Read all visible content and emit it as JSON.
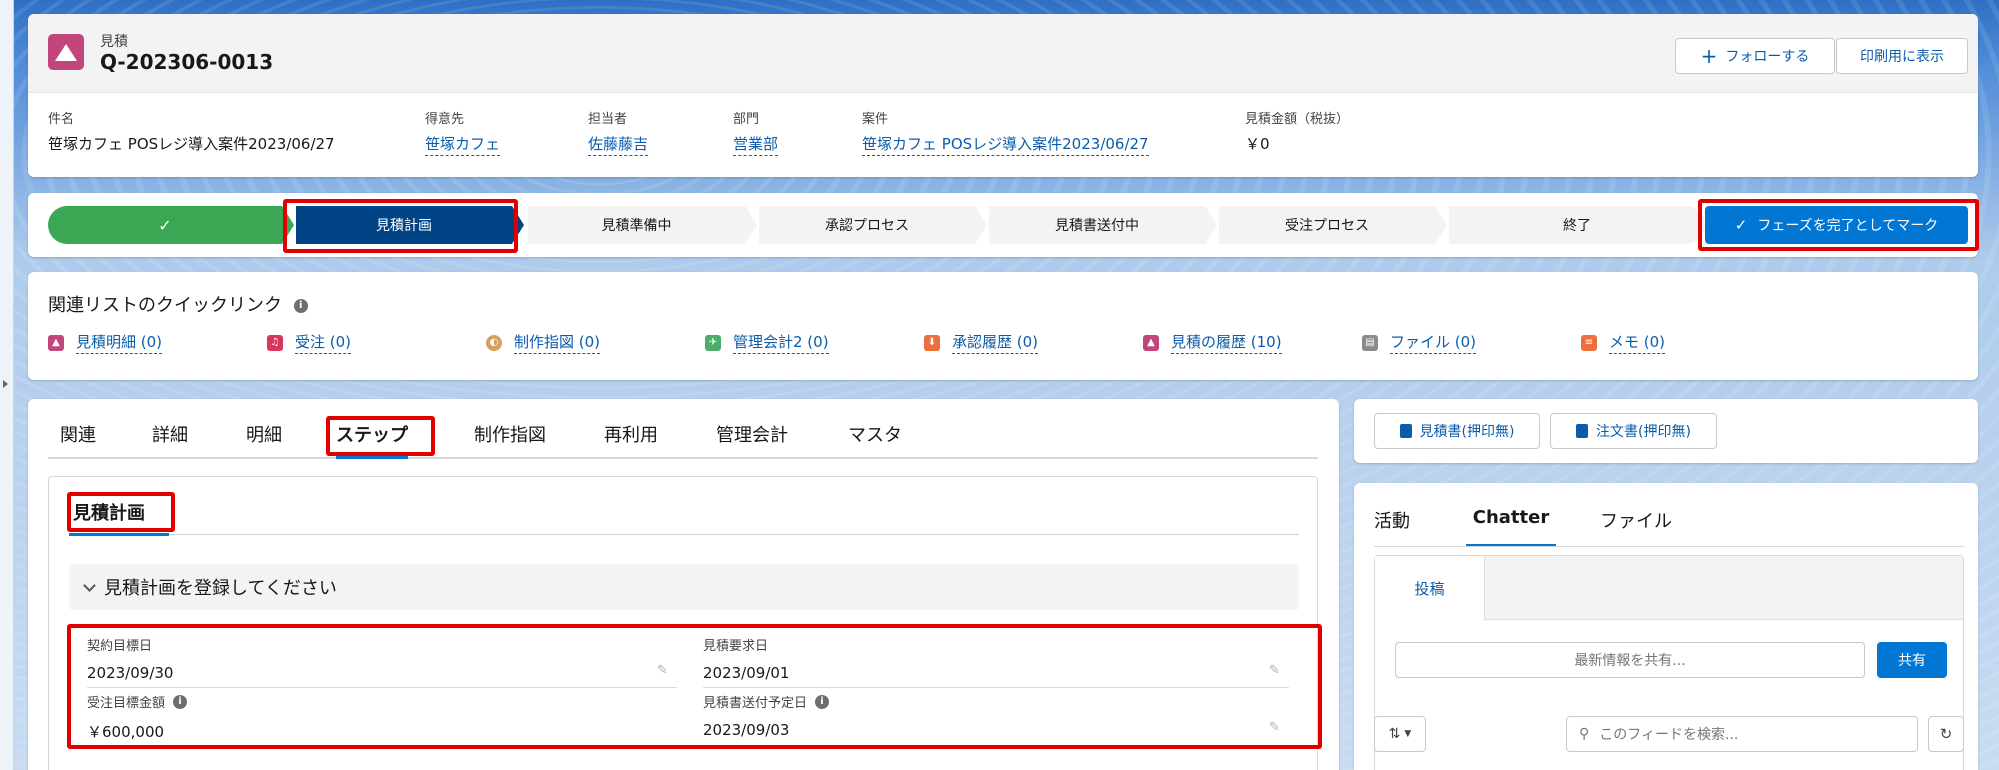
{
  "header": {
    "object_label": "見積",
    "record_name": "Q-202306-0013",
    "follow_label": "フォローする",
    "print_label": "印刷用に表示",
    "fields": [
      {
        "label": "件名",
        "value": "笹塚カフェ POSレジ導入案件2023/06/27"
      },
      {
        "label": "得意先",
        "value": "笹塚カフェ"
      },
      {
        "label": "担当者",
        "value": "佐藤藤吉"
      },
      {
        "label": "部門",
        "value": "営業部"
      },
      {
        "label": "案件",
        "value": "笹塚カフェ POSレジ導入案件2023/06/27"
      },
      {
        "label": "見積金額（税抜）",
        "value": "￥0"
      }
    ]
  },
  "path": {
    "stages": [
      "",
      "見積計画",
      "見積準備中",
      "承認プロセス",
      "見積書送付中",
      "受注プロセス",
      "終了"
    ],
    "mark_complete_label": "フェーズを完了としてマーク",
    "colors": {
      "done": "#3ba755",
      "current": "#014486",
      "todo": "#f3f3f3"
    }
  },
  "quicklinks": {
    "title": "関連リストのクイックリンク",
    "items": [
      {
        "label": "見積明細 (0)",
        "icon": "quote-icon",
        "color": "#c2457b"
      },
      {
        "label": "受注 (0)",
        "icon": "order-icon",
        "color": "#d8375d"
      },
      {
        "label": "制作指図 (0)",
        "icon": "production-icon",
        "color": "#d5a05e"
      },
      {
        "label": "管理会計2 (0)",
        "icon": "accounting-icon",
        "color": "#4bad6a"
      },
      {
        "label": "承認履歴 (0)",
        "icon": "approval-icon",
        "color": "#ef6e3e"
      },
      {
        "label": "見積の履歴 (10)",
        "icon": "history-icon",
        "color": "#c2457b"
      },
      {
        "label": "ファイル (0)",
        "icon": "file-icon",
        "color": "#8a8a8a"
      },
      {
        "label": "メモ (0)",
        "icon": "note-icon",
        "color": "#ef6e3e"
      }
    ]
  },
  "main": {
    "tabs": [
      "関連",
      "詳細",
      "明細",
      "ステップ",
      "制作指図",
      "再利用",
      "管理会計",
      "マスタ"
    ],
    "active_tab": "ステップ",
    "section_title": "見積計画",
    "accordion_label": "見積計画を登録してください",
    "form": [
      {
        "label": "契約目標日",
        "value": "2023/09/30"
      },
      {
        "label": "見積要求日",
        "value": "2023/09/01"
      },
      {
        "label": "受注目標金額",
        "value": "￥600,000"
      },
      {
        "label": "見積書送付予定日",
        "value": "2023/09/03"
      }
    ]
  },
  "actions": {
    "quote_btn": "見積書(押印無)",
    "order_btn": "注文書(押印無)"
  },
  "chatter": {
    "tabs": [
      "活動",
      "Chatter",
      "ファイル"
    ],
    "active_tab": "Chatter",
    "post_tab": "投稿",
    "share_placeholder": "最新情報を共有...",
    "share_btn": "共有",
    "search_placeholder": "このフィードを検索..."
  }
}
